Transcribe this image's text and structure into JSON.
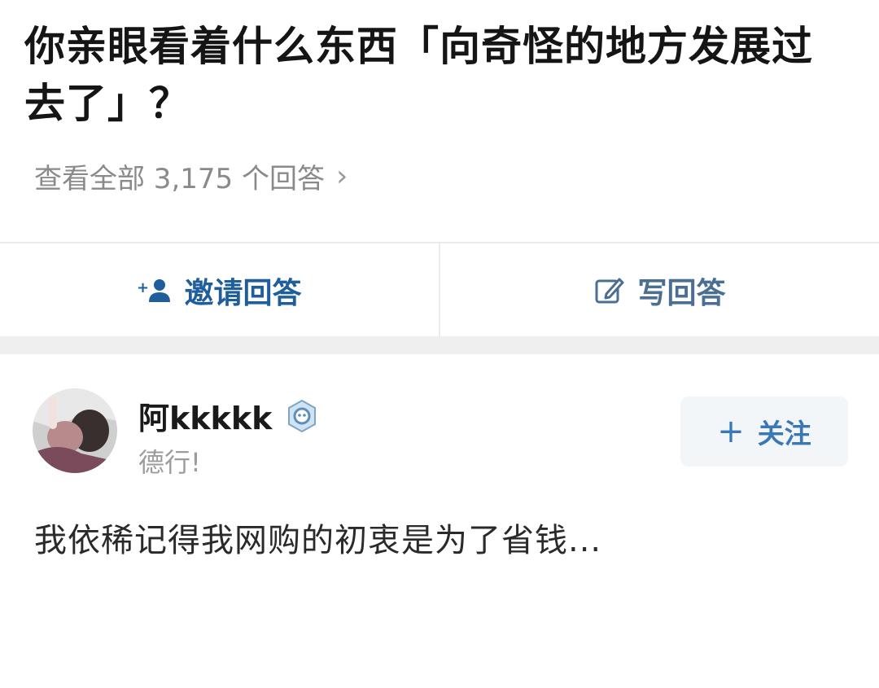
{
  "question": {
    "title": "你亲眼看着什么东西「向奇怪的地方发展过去了」？",
    "view_all_label": "查看全部 3,175 个回答"
  },
  "actions": {
    "invite_label": "邀请回答",
    "write_label": "写回答"
  },
  "answer": {
    "author_name": "阿kkkkk",
    "author_bio": "德行!",
    "follow_label": "关注",
    "content": "我依稀记得我网购的初衷是为了省钱..."
  },
  "icons": {
    "invite": "add-user-icon",
    "write": "edit-icon",
    "badge": "verified-badge-icon",
    "chevron": "chevron-right-icon",
    "follow": "plus-icon"
  },
  "colors": {
    "accent": "#1f5e9c",
    "follow_bg": "#f3f6f8",
    "muted_text": "#8a8a8a"
  }
}
